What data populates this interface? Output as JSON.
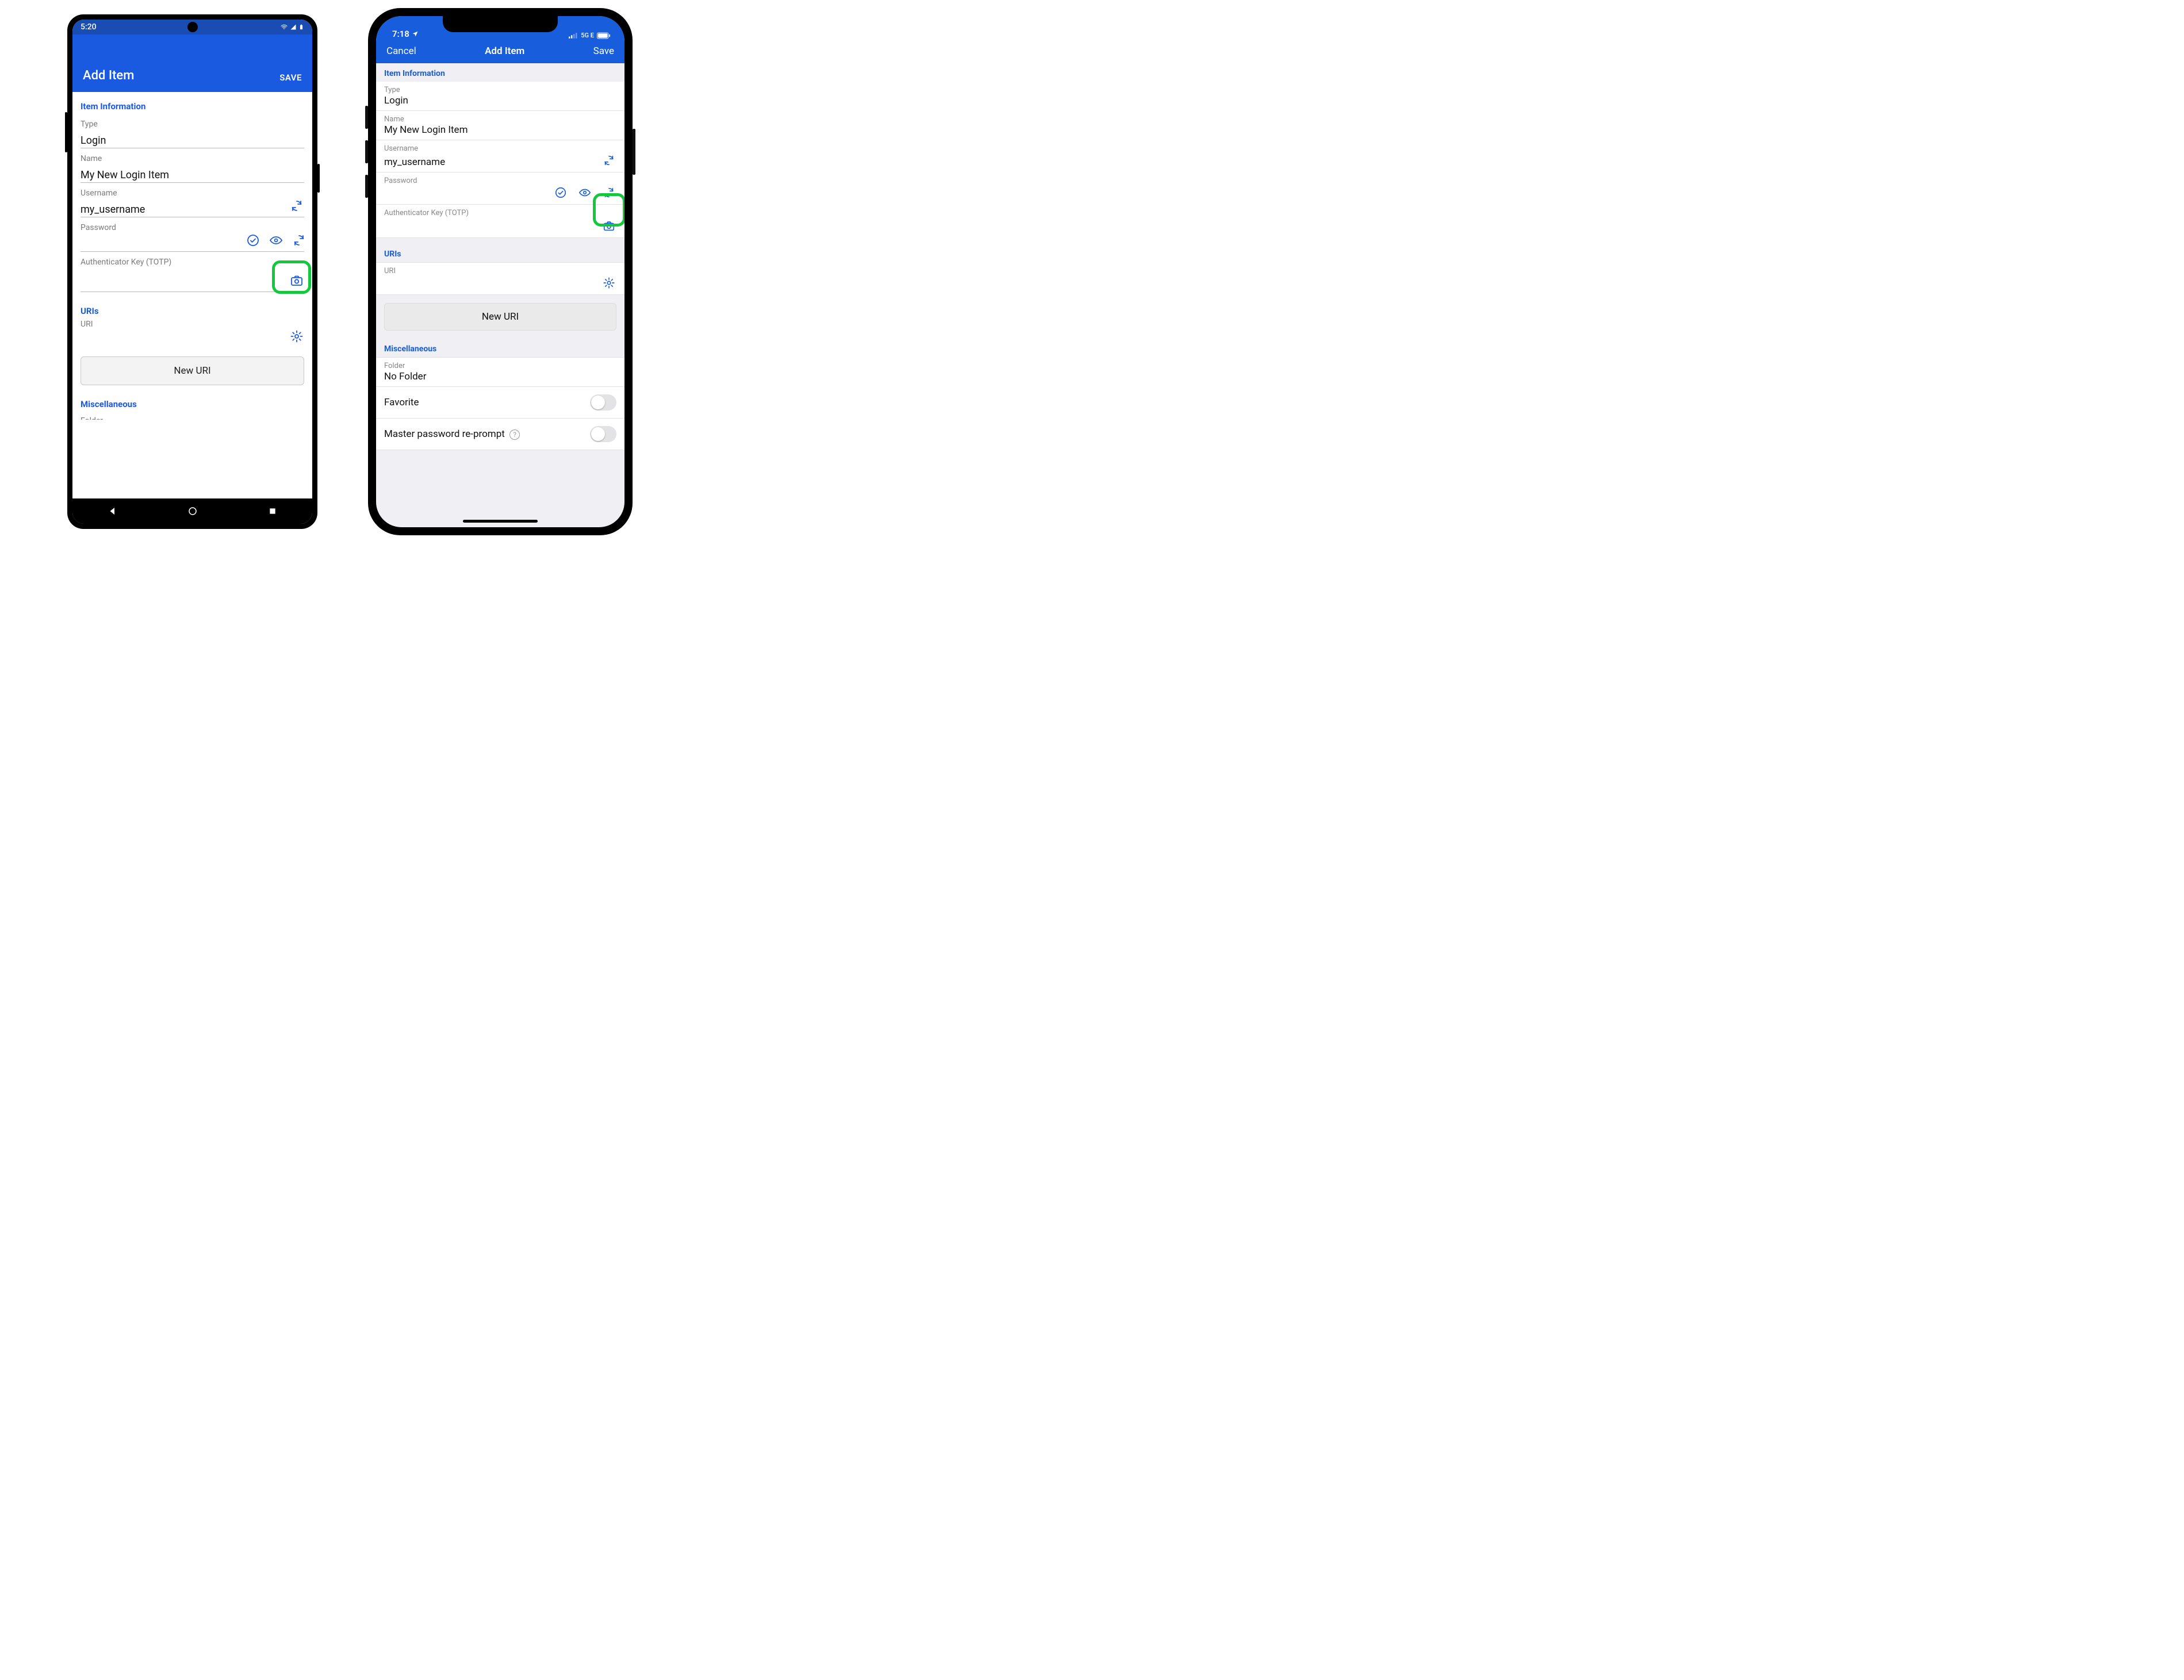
{
  "android": {
    "status": {
      "time": "5:20"
    },
    "appbar": {
      "title": "Add Item",
      "save": "SAVE"
    },
    "sections": {
      "item_info": "Item Information",
      "uris": "URIs",
      "misc": "Miscellaneous"
    },
    "fields": {
      "type": {
        "label": "Type",
        "value": "Login"
      },
      "name": {
        "label": "Name",
        "value": "My New Login Item"
      },
      "username": {
        "label": "Username",
        "value": "my_username"
      },
      "password": {
        "label": "Password",
        "value": ""
      },
      "totp": {
        "label": "Authenticator Key (TOTP)",
        "value": ""
      },
      "uri": {
        "label": "URI",
        "value": ""
      },
      "folder": {
        "label": "Folder"
      }
    },
    "buttons": {
      "new_uri": "New URI"
    }
  },
  "ios": {
    "status": {
      "time": "7:18",
      "network": "5G E"
    },
    "navbar": {
      "cancel": "Cancel",
      "title": "Add Item",
      "save": "Save"
    },
    "sections": {
      "item_info": "Item Information",
      "uris": "URIs",
      "misc": "Miscellaneous"
    },
    "fields": {
      "type": {
        "label": "Type",
        "value": "Login"
      },
      "name": {
        "label": "Name",
        "value": "My New Login Item"
      },
      "username": {
        "label": "Username",
        "value": "my_username"
      },
      "password": {
        "label": "Password",
        "value": ""
      },
      "totp": {
        "label": "Authenticator Key (TOTP)",
        "value": ""
      },
      "uri": {
        "label": "URI",
        "value": ""
      },
      "folder": {
        "label": "Folder",
        "value": "No Folder"
      },
      "favorite": {
        "label": "Favorite"
      },
      "reprompt": {
        "label": "Master password re-prompt"
      }
    },
    "buttons": {
      "new_uri": "New URI"
    }
  },
  "colors": {
    "brand_blue": "#175ddc",
    "android_blue": "#1a5ae0",
    "highlight_green": "#14c73c"
  }
}
